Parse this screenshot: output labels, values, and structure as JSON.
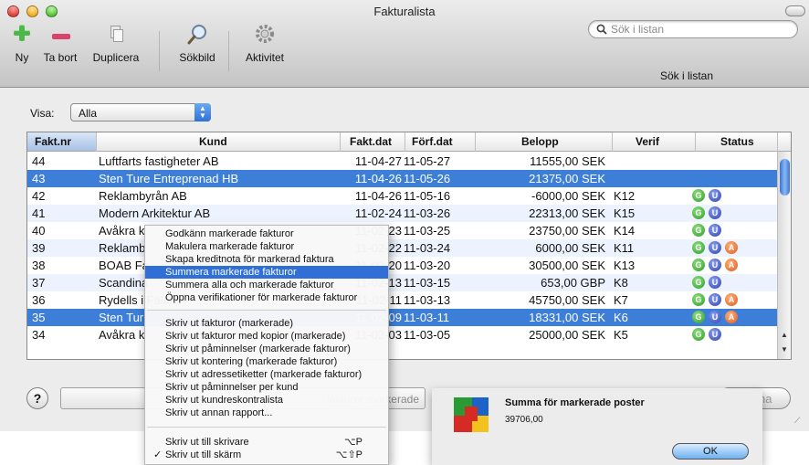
{
  "window": {
    "title": "Fakturalista"
  },
  "toolbar": {
    "new_label": "Ny",
    "delete_label": "Ta bort",
    "duplicate_label": "Duplicera",
    "searchimage_label": "Sökbild",
    "activity_label": "Aktivitet"
  },
  "search": {
    "placeholder": "Sök i listan",
    "caption": "Sök i listan"
  },
  "filter": {
    "label": "Visa:",
    "value": "Alla"
  },
  "table": {
    "headers": {
      "nr": "Fakt.nr",
      "kund": "Kund",
      "fakt": "Fakt.dat",
      "forf": "Förf.dat",
      "belopp": "Belopp",
      "verif": "Verif",
      "status": "Status"
    },
    "rows": [
      {
        "nr": "44",
        "kund": "Luftfarts fastigheter AB",
        "fakt": "11-04-27",
        "forf": "11-05-27",
        "belopp": "11555,00 SEK",
        "verif": "",
        "status": [],
        "selected": false
      },
      {
        "nr": "43",
        "kund": "Sten Ture Entreprenad HB",
        "fakt": "11-04-26",
        "forf": "11-05-26",
        "belopp": "21375,00 SEK",
        "verif": "",
        "status": [],
        "selected": true
      },
      {
        "nr": "42",
        "kund": "Reklambyrån AB",
        "fakt": "11-04-26",
        "forf": "11-05-16",
        "belopp": "-6000,00 SEK",
        "verif": "K12",
        "status": [
          "G",
          "U"
        ],
        "selected": false
      },
      {
        "nr": "41",
        "kund": "Modern Arkitektur AB",
        "fakt": "11-02-24",
        "forf": "11-03-26",
        "belopp": "22313,00 SEK",
        "verif": "K15",
        "status": [
          "G",
          "U"
        ],
        "selected": false
      },
      {
        "nr": "40",
        "kund": "Avåkra k",
        "fakt": "11-02-23",
        "forf": "11-03-25",
        "belopp": "23750,00 SEK",
        "verif": "K14",
        "status": [
          "G",
          "U"
        ],
        "selected": false
      },
      {
        "nr": "39",
        "kund": "Reklamb",
        "fakt": "11-02-22",
        "forf": "11-03-24",
        "belopp": "6000,00 SEK",
        "verif": "K11",
        "status": [
          "G",
          "U",
          "A"
        ],
        "selected": false
      },
      {
        "nr": "38",
        "kund": "BOAB Fa",
        "fakt": "11-02-20",
        "forf": "11-03-20",
        "belopp": "30500,00 SEK",
        "verif": "K13",
        "status": [
          "G",
          "U",
          "A"
        ],
        "selected": false
      },
      {
        "nr": "37",
        "kund": "Scandina",
        "fakt": "11-02-13",
        "forf": "11-03-15",
        "belopp": "653,00 GBP",
        "verif": "K8",
        "status": [
          "G",
          "U"
        ],
        "selected": false
      },
      {
        "nr": "36",
        "kund": "Rydells i Falun",
        "fakt": "11-02-11",
        "forf": "11-03-13",
        "belopp": "45750,00 SEK",
        "verif": "K7",
        "status": [
          "G",
          "U",
          "A"
        ],
        "selected": false
      },
      {
        "nr": "35",
        "kund": "Sten Tur",
        "fakt": "11-02-09",
        "forf": "11-03-11",
        "belopp": "18331,00 SEK",
        "verif": "K6",
        "status": [
          "G",
          "U",
          "A"
        ],
        "selected": true
      },
      {
        "nr": "34",
        "kund": "Avåkra k",
        "fakt": "11-02-03",
        "forf": "11-03-05",
        "belopp": "25000,00 SEK",
        "verif": "K5",
        "status": [
          "G",
          "U"
        ],
        "selected": false
      }
    ]
  },
  "bottom": {
    "field_text": "fakturor markerade",
    "open_label": "Öppna",
    "help_label": "?"
  },
  "menu": {
    "items": [
      "Godkänn markerade fakturor",
      "Makulera markerade fakturor",
      "Skapa kreditnota för markerad faktura",
      "Summera markerade fakturor",
      "Summera alla och markerade fakturor",
      "Öppna verifikationer för markerade fakturor",
      "Skriv ut fakturor (markerade)",
      "Skriv ut fakturor med kopior (markerade)",
      "Skriv ut påminnelser (markerade fakturor)",
      "Skriv ut kontering (markerade fakturor)",
      "Skriv ut adressetiketter (markerade fakturor)",
      "Skriv ut påminnelser per kund",
      "Skriv ut kundreskontralista",
      "Skriv ut annan rapport...",
      "Skriv ut till skrivare",
      "Skriv ut till skärm"
    ],
    "shortcut_printer": "⌥P",
    "shortcut_screen": "⌥⇧P",
    "checkmark": "✓",
    "highlighted_index": 3
  },
  "panel": {
    "title": "Summa för markerade poster",
    "value": "39706,00",
    "ok_label": "OK"
  },
  "colors": {
    "selection": "#3d7fd8",
    "menu_highlight": "#2f6fd6",
    "badge_g": "#2f9c2b",
    "badge_u": "#2c3fb1",
    "badge_a": "#e0581e"
  }
}
